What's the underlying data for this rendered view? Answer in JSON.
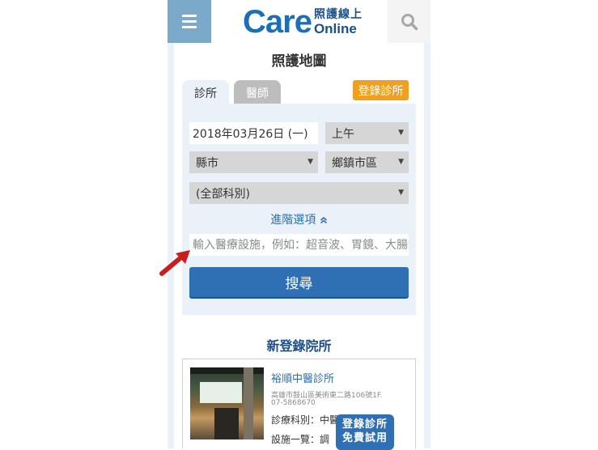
{
  "header": {
    "logo_main": "Care",
    "logo_zh": "照護線上",
    "logo_en": "Online",
    "menu_icon": "hamburger-menu-icon",
    "search_icon": "search-icon"
  },
  "page": {
    "title": "照護地圖"
  },
  "tabs": [
    {
      "label": "診所",
      "active": true
    },
    {
      "label": "醫師",
      "active": false
    }
  ],
  "register_button": "登錄診所",
  "form": {
    "date_value": "2018年03月26日 (一)",
    "session": "上午",
    "county": "縣市",
    "district": "鄉鎮市區",
    "department": "(全部科別)",
    "advanced_label": "進階選項",
    "keyword_placeholder": "輸入醫療設施，例如：超音波、胃鏡、大腸鏡",
    "search_label": "搜尋"
  },
  "new_clinics": {
    "title": "新登錄院所",
    "items": [
      {
        "name": "裕順中醫診所",
        "address": "高雄市鼓山區美術東二路106號1F.",
        "phone": "07-5868670",
        "dept_label": "診療科別：中醫",
        "facility_label": "設施一覽：調"
      }
    ]
  },
  "floating_button": {
    "line1": "登錄診所",
    "line2": "免費試用"
  },
  "colors": {
    "brand_blue": "#1c6fb4",
    "menu_bg": "#7aa9c9",
    "accent_orange": "#f0a020",
    "button_blue": "#2f6fb3",
    "arrow_red": "#c81e1e"
  }
}
